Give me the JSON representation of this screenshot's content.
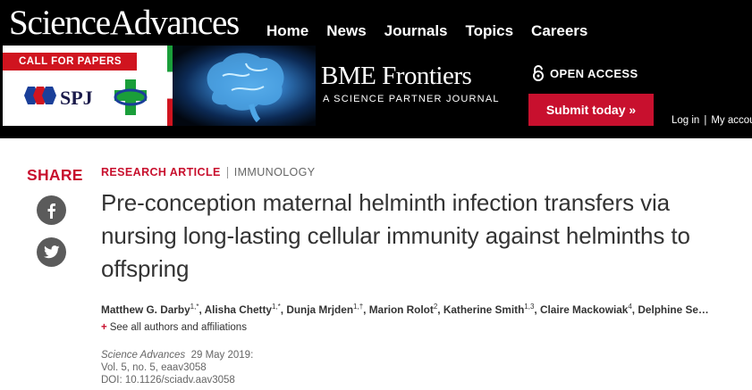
{
  "header": {
    "logo_text": "ScienceAdvances",
    "nav": [
      "Home",
      "News",
      "Journals",
      "Topics",
      "Careers"
    ],
    "account": {
      "login": "Log in",
      "separator": "|",
      "my_account": "My accou"
    }
  },
  "ad": {
    "call_for_papers": "CALL FOR PAPERS",
    "spj_text": "SPJ",
    "journal_title": "BME Frontiers",
    "journal_subtitle": "A SCIENCE PARTNER JOURNAL",
    "open_access": "OPEN ACCESS",
    "submit_label": "Submit today »"
  },
  "share": {
    "title": "SHARE"
  },
  "article": {
    "type": "RESEARCH ARTICLE",
    "subject": "IMMUNOLOGY",
    "title": "Pre-conception maternal helminth infection transfers via nursing long-lasting cellular immunity against helminths to offspring",
    "authors": [
      {
        "name": "Matthew G. Darby",
        "aff": "1,*"
      },
      {
        "name": "Alisha Chetty",
        "aff": "1,*"
      },
      {
        "name": "Dunja Mrjden",
        "aff": "1,†"
      },
      {
        "name": "Marion Rolot",
        "aff": "2"
      },
      {
        "name": "Katherine Smith",
        "aff": "1,3"
      },
      {
        "name": "Claire Mackowiak",
        "aff": "4"
      },
      {
        "name": "Delphine Se…",
        "aff": ""
      }
    ],
    "see_all": "See all authors and affiliations",
    "journal": "Science Advances",
    "date": "29 May 2019:",
    "volume": "Vol. 5, no. 5, eaav3058",
    "doi": "DOI: 10.1126/sciadv.aav3058"
  },
  "colors": {
    "accent": "#c8102e",
    "header_bg": "#000000",
    "share_icon_bg": "#5b5b5b"
  }
}
